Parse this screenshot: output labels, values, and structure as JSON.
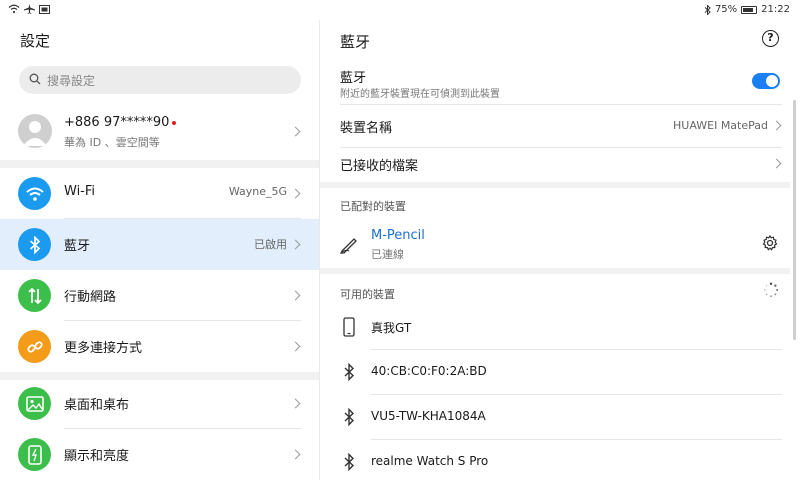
{
  "status": {
    "battery": "75%",
    "time": "21:22"
  },
  "left": {
    "title": "設定",
    "search_placeholder": "搜尋設定",
    "account": {
      "phone": "+886 97*****90",
      "subtitle": "華為 ID 、雲空間等"
    },
    "items": [
      {
        "label": "Wi-Fi",
        "value": "Wayne_5G",
        "icon": "wifi-icon",
        "color": "#1b9bef"
      },
      {
        "label": "藍牙",
        "value": "已啟用",
        "icon": "bluetooth-icon",
        "color": "#1b9bef"
      },
      {
        "label": "行動網路",
        "value": "",
        "icon": "mobile-data-icon",
        "color": "#3cbf4a"
      },
      {
        "label": "更多連接方式",
        "value": "",
        "icon": "link-icon",
        "color": "#f49b19"
      },
      {
        "label": "桌面和桌布",
        "value": "",
        "icon": "wallpaper-icon",
        "color": "#3cbf4a"
      },
      {
        "label": "顯示和亮度",
        "value": "",
        "icon": "display-icon",
        "color": "#3cbf4a"
      }
    ]
  },
  "right": {
    "title": "藍牙",
    "bluetooth": {
      "label": "藍牙",
      "desc": "附近的藍牙裝置現在可偵測到此裝置",
      "enabled": true
    },
    "device_name_label": "裝置名稱",
    "device_name_value": "HUAWEI MatePad",
    "received_files_label": "已接收的檔案",
    "paired_header": "已配對的裝置",
    "paired": {
      "name": "M-Pencil",
      "status": "已連線"
    },
    "available_header": "可用的裝置",
    "available": [
      {
        "name": "真我GT",
        "icon": "phone-icon"
      },
      {
        "name": "40:CB:C0:F0:2A:BD",
        "icon": "bluetooth-icon"
      },
      {
        "name": "VU5-TW-KHA1084A",
        "icon": "bluetooth-icon"
      },
      {
        "name": "realme Watch S Pro",
        "icon": "bluetooth-icon"
      }
    ]
  },
  "colors": {
    "accent": "#1a7ff0",
    "link": "#1a6fd6"
  }
}
